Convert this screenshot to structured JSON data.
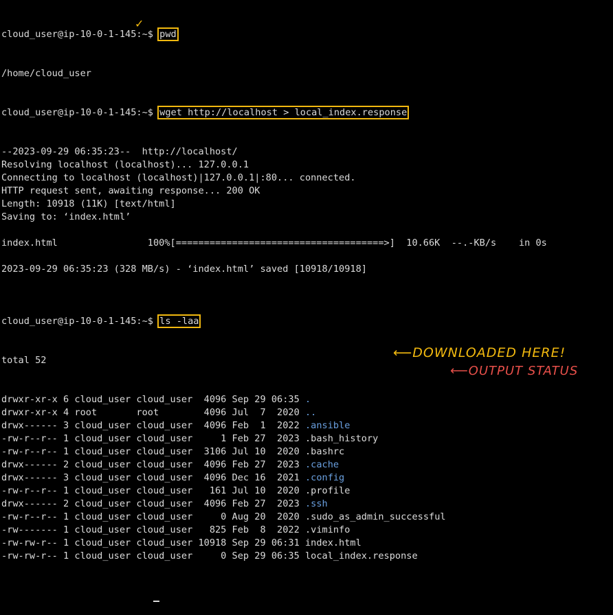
{
  "terminal": {
    "prompt": "cloud_user@ip-10-0-1-145:~$ ",
    "cmd_pwd": "pwd",
    "out_pwd": "/home/cloud_user",
    "cmd_wget": "wget http://localhost > local_index.response",
    "wget_output": [
      "--2023-09-29 06:35:23--  http://localhost/",
      "Resolving localhost (localhost)... 127.0.0.1",
      "Connecting to localhost (localhost)|127.0.0.1|:80... connected.",
      "HTTP request sent, awaiting response... 200 OK",
      "Length: 10918 (11K) [text/html]",
      "Saving to: ‘index.html’",
      "",
      "index.html                100%[=====================================>]  10.66K  --.-KB/s    in 0s",
      "",
      "2023-09-29 06:35:23 (328 MB/s) - ‘index.html’ saved [10918/10918]",
      ""
    ],
    "cmd_ls": "ls -laa",
    "ls_total": "total 52",
    "ls_rows": [
      {
        "meta": "drwxr-xr-x 6 cloud_user cloud_user  4096 Sep 29 06:35 ",
        "name": ".",
        "dir": true
      },
      {
        "meta": "drwxr-xr-x 4 root       root        4096 Jul  7  2020 ",
        "name": "..",
        "dir": true
      },
      {
        "meta": "drwx------ 3 cloud_user cloud_user  4096 Feb  1  2022 ",
        "name": ".ansible",
        "dir": true
      },
      {
        "meta": "-rw-r--r-- 1 cloud_user cloud_user     1 Feb 27  2023 ",
        "name": ".bash_history",
        "dir": false
      },
      {
        "meta": "-rw-r--r-- 1 cloud_user cloud_user  3106 Jul 10  2020 ",
        "name": ".bashrc",
        "dir": false
      },
      {
        "meta": "drwx------ 2 cloud_user cloud_user  4096 Feb 27  2023 ",
        "name": ".cache",
        "dir": true
      },
      {
        "meta": "drwx------ 3 cloud_user cloud_user  4096 Dec 16  2021 ",
        "name": ".config",
        "dir": true
      },
      {
        "meta": "-rw-r--r-- 1 cloud_user cloud_user   161 Jul 10  2020 ",
        "name": ".profile",
        "dir": false
      },
      {
        "meta": "drwx------ 2 cloud_user cloud_user  4096 Feb 27  2023 ",
        "name": ".ssh",
        "dir": true
      },
      {
        "meta": "-rw-r--r-- 1 cloud_user cloud_user     0 Aug 20  2020 ",
        "name": ".sudo_as_admin_successful",
        "dir": false
      },
      {
        "meta": "-rw------- 1 cloud_user cloud_user   825 Feb  8  2022 ",
        "name": ".viminfo",
        "dir": false
      },
      {
        "meta": "-rw-rw-r-- 1 cloud_user cloud_user 10918 Sep 29 06:31 ",
        "name": "index.html",
        "dir": false
      },
      {
        "meta": "-rw-rw-r-- 1 cloud_user cloud_user     0 Sep 29 06:35 ",
        "name": "local_index.response",
        "dir": false
      }
    ]
  },
  "annotations": {
    "check": "✓",
    "downloaded": "⟵DOWNLOADED HERE!",
    "output": "⟵OUTPUT STATUS"
  },
  "colors": {
    "background": "#000000",
    "text": "#dcdcdc",
    "directory": "#6aa0e0",
    "highlight_box": "#f2b90f",
    "annotation_red": "#e8504a"
  }
}
